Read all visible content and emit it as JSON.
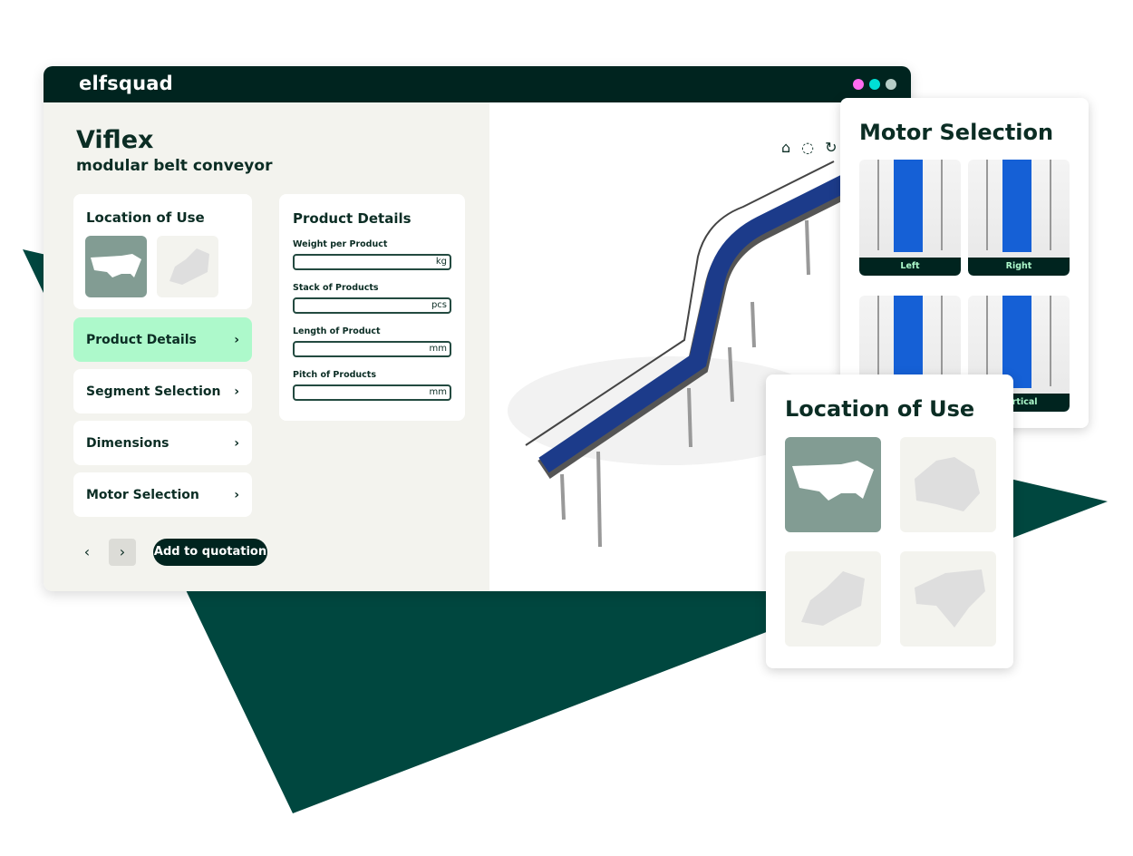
{
  "brand": {
    "logo": "elfsquad",
    "window_dots": [
      "#ff6cf0",
      "#00e0d5",
      "#b7cdc7"
    ],
    "accent": "#00473f",
    "highlight": "#adf9cb"
  },
  "product": {
    "title": "Viflex",
    "subtitle": "modular belt conveyor"
  },
  "location_card": {
    "title": "Location of Use",
    "options": [
      {
        "region": "usa",
        "selected": true
      },
      {
        "region": "europe",
        "selected": false
      }
    ]
  },
  "product_details": {
    "title": "Product Details",
    "fields": [
      {
        "label": "Weight per Product",
        "value": "",
        "unit": "kg"
      },
      {
        "label": "Stack of Products",
        "value": "",
        "unit": "pcs"
      },
      {
        "label": "Length of Product",
        "value": "",
        "unit": "mm"
      },
      {
        "label": "Pitch of Products",
        "value": "",
        "unit": "mm"
      }
    ]
  },
  "steps": [
    {
      "label": "Product Details",
      "active": true
    },
    {
      "label": "Segment Selection"
    },
    {
      "label": "Dimensions"
    },
    {
      "label": "Motor Selection"
    }
  ],
  "footer": {
    "prev": "‹",
    "next": "›",
    "add_label": "Add to quotation"
  },
  "viewer": {
    "icons": [
      "home-icon",
      "focus-icon",
      "rotate-icon"
    ]
  },
  "motor_popup": {
    "title": "Motor Selection",
    "options": [
      "Left",
      "Right",
      "",
      "Vertical"
    ]
  },
  "location_popup": {
    "title": "Location of Use",
    "options": [
      {
        "region": "usa",
        "selected": true
      },
      {
        "region": "australia"
      },
      {
        "region": "europe"
      },
      {
        "region": "asia"
      }
    ]
  }
}
